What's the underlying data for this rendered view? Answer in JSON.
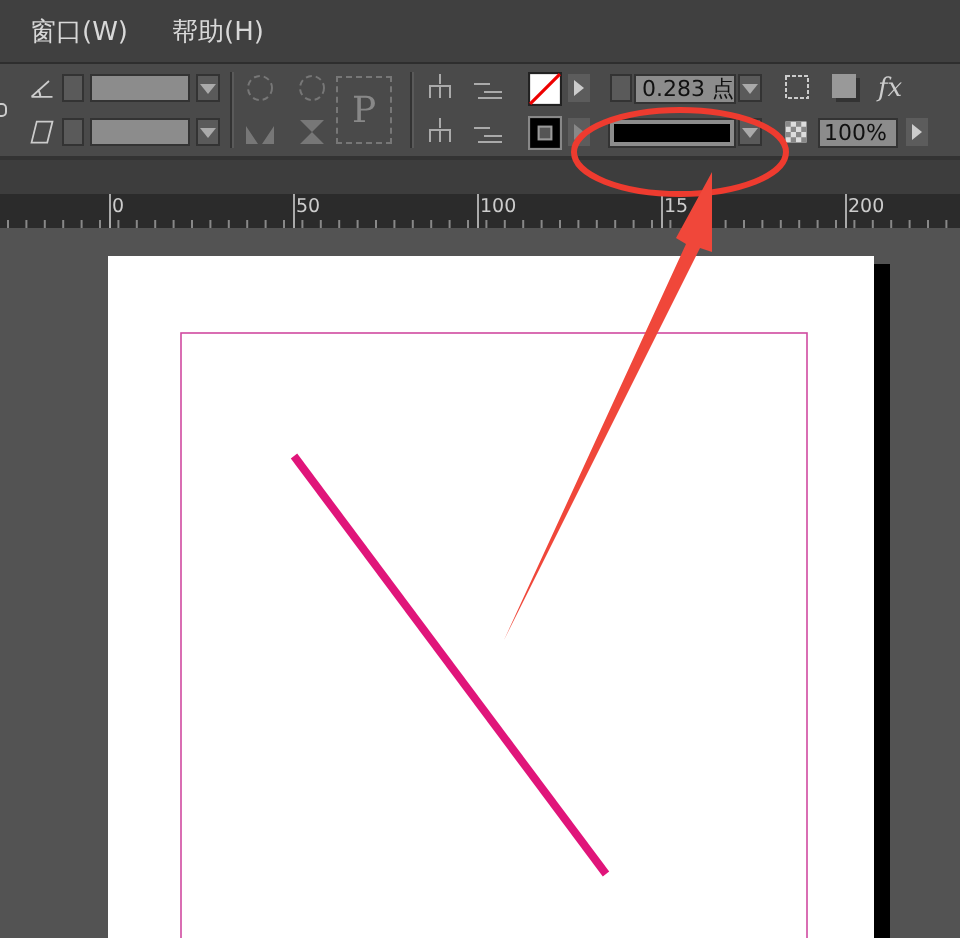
{
  "menu": [
    {
      "label": "窗口(W)"
    },
    {
      "label": "帮助(H)"
    }
  ],
  "toolbar": {
    "frame_label": "P",
    "stroke_weight": "0.283 点",
    "opacity": "100%",
    "effects_label": "fx"
  },
  "ruler": {
    "labels": [
      "0",
      "50",
      "100",
      "15",
      "200"
    ]
  }
}
